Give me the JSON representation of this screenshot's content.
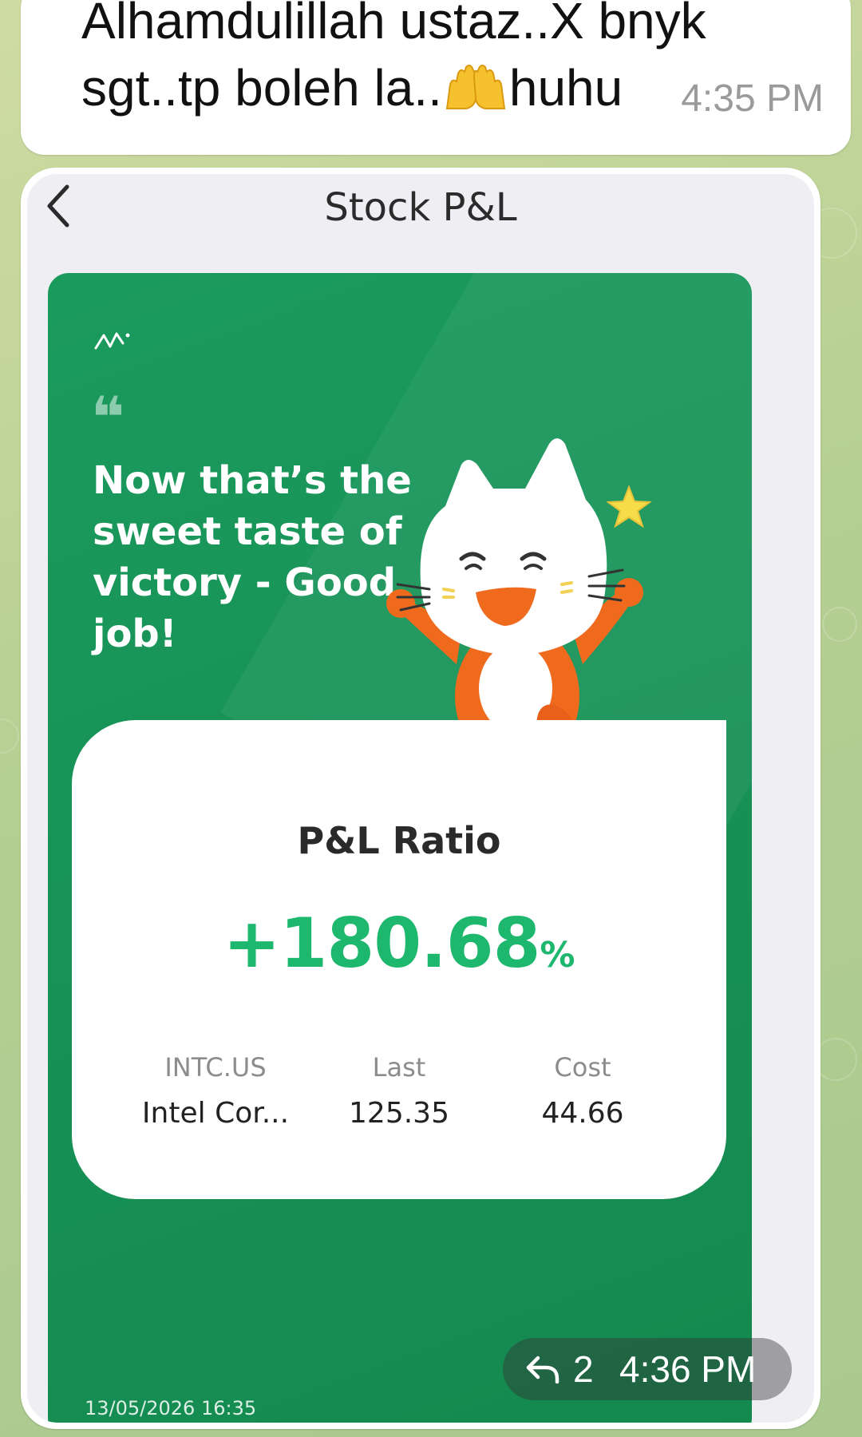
{
  "message": {
    "text_before_emoji": "Alhamdulillah ustaz..X bnyk sgt..tp boleh la..",
    "text_after_emoji": "huhu",
    "emoji_icon": "raising-hands-emoji",
    "time": "4:35 PM"
  },
  "image_message": {
    "reply_count": "2",
    "time": "4:36 PM",
    "reply_icon": "reply-arrow-icon"
  },
  "screenshot": {
    "nav_title": "Stock P&L",
    "back_icon": "chevron-left-icon",
    "quote_mark": "❝",
    "quote": "Now that’s the sweet taste of victory - Good job!",
    "pnl_label": "P&L Ratio",
    "pnl_value": "+180.68",
    "pnl_unit": "%",
    "symbol": "INTC.US",
    "company": "Intel Cor...",
    "last_label": "Last",
    "last_value": "125.35",
    "cost_label": "Cost",
    "cost_value": "44.66",
    "date": "13/05/2026 16:35"
  },
  "colors": {
    "card_green": "#1b9a5e",
    "pnl_green": "#1db76e",
    "mascot_orange": "#f06a1e"
  }
}
